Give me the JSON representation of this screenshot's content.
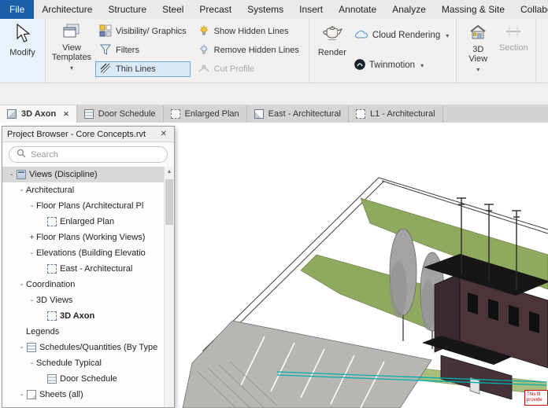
{
  "colors": {
    "file_tab_blue": "#1a5fa8",
    "active_tool_bg": "#d9e9f7",
    "active_tool_border": "#6aa6dc",
    "lawn": "#8fa95f",
    "lawn_light": "#a9bf7d",
    "parking": "#b7b6b3",
    "building": "#4b3539",
    "building_side": "#3a292d",
    "roof": "#161616",
    "tree": "#a3a3a1",
    "teal": "#00aeae",
    "error_red": "#cc0000"
  },
  "ribbon": {
    "file_tab": "File",
    "tabs": [
      "Architecture",
      "Structure",
      "Steel",
      "Precast",
      "Systems",
      "Insert",
      "Annotate",
      "Analyze",
      "Massing & Site",
      "Collabo"
    ]
  },
  "toolbar": {
    "modify_label": "Modify",
    "view_templates_label": "View Templates",
    "visibility_graphics_label": "Visibility/ Graphics",
    "filters_label": "Filters",
    "thin_lines_label": "Thin Lines",
    "show_hidden_lines_label": "Show Hidden Lines",
    "remove_hidden_lines_label": "Remove Hidden Lines",
    "cut_profile_label": "Cut Profile",
    "render_label": "Render",
    "cloud_rendering_label": "Cloud Rendering",
    "twinmotion_label": "Twinmotion",
    "three_d_view_label": "3D View",
    "section_label": "Section"
  },
  "view_tabs": [
    {
      "label": "3D Axon",
      "icon": "axon",
      "active": true
    },
    {
      "label": "Door Schedule",
      "icon": "schedule",
      "active": false
    },
    {
      "label": "Enlarged Plan",
      "icon": "plan",
      "active": false
    },
    {
      "label": "East - Architectural",
      "icon": "elevation",
      "active": false
    },
    {
      "label": "L1 - Architectural",
      "icon": "plan",
      "active": false
    }
  ],
  "project_browser": {
    "title": "Project Browser - Core Concepts.rvt",
    "search_placeholder": "Search",
    "tree": [
      {
        "label": "Views (Discipline)",
        "level": 0,
        "glyph": "-",
        "icon": "views-cat",
        "selected": true
      },
      {
        "label": "Architectural",
        "level": 1,
        "glyph": "-"
      },
      {
        "label": "Floor Plans (Architectural Pl",
        "level": 2,
        "glyph": "-"
      },
      {
        "label": "Enlarged Plan",
        "level": 3,
        "icon": "view"
      },
      {
        "label": "Floor Plans (Working Views)",
        "level": 2,
        "glyph": "+"
      },
      {
        "label": "Elevations (Building Elevatio",
        "level": 2,
        "glyph": "-"
      },
      {
        "label": "East - Architectural",
        "level": 3,
        "icon": "view"
      },
      {
        "label": "Coordination",
        "level": 1,
        "glyph": "-"
      },
      {
        "label": "3D Views",
        "level": 2,
        "glyph": "-"
      },
      {
        "label": "3D Axon",
        "level": 3,
        "icon": "view",
        "bold": true
      },
      {
        "label": "Legends",
        "level": 1
      },
      {
        "label": "Schedules/Quantities (By Type",
        "level": 1,
        "glyph": "-",
        "icon": "schedule-cat"
      },
      {
        "label": "Schedule Typical",
        "level": 2,
        "glyph": "-"
      },
      {
        "label": "Door Schedule",
        "level": 3,
        "icon": "schedule-item"
      },
      {
        "label": "Sheets (all)",
        "level": 1,
        "glyph": "-",
        "icon": "sheets-cat"
      }
    ]
  },
  "canvas": {
    "tooltip": {
      "line1": "This fil",
      "line2": "provide"
    }
  }
}
